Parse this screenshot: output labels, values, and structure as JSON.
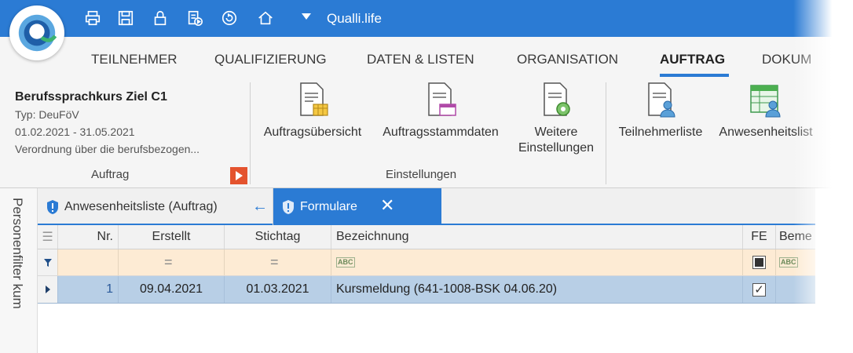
{
  "app": {
    "title": "Qualli.life",
    "brand_color": "#2b7bd4",
    "accent_color": "#e4532e"
  },
  "quick_access": [
    {
      "icon": "print-icon"
    },
    {
      "icon": "save-icon"
    },
    {
      "icon": "lock-icon"
    },
    {
      "icon": "report-play-icon"
    },
    {
      "icon": "refresh-icon"
    },
    {
      "icon": "home-icon"
    }
  ],
  "ribbon_tabs": [
    {
      "label": "TEILNEHMER"
    },
    {
      "label": "QUALIFIZIERUNG"
    },
    {
      "label": "DATEN & LISTEN"
    },
    {
      "label": "ORGANISATION"
    },
    {
      "label": "AUFTRAG",
      "active": true
    },
    {
      "label": "DOKUM"
    }
  ],
  "info": {
    "title": "Berufssprachkurs Ziel C1",
    "type": "Typ: DeuFöV",
    "period": "01.02.2021 - 31.05.2021",
    "regulation": "Verordnung über die berufsbezogen...",
    "group_label": "Auftrag"
  },
  "settings_group": {
    "label": "Einstellungen",
    "buttons": [
      {
        "label": "Auftragsübersicht",
        "icon": "document-table-icon"
      },
      {
        "label": "Auftragsstammdaten",
        "icon": "document-form-icon"
      },
      {
        "label_line1": "Weitere",
        "label_line2": "Einstellungen",
        "icon": "document-settings-icon"
      }
    ]
  },
  "list_group": {
    "buttons": [
      {
        "label": "Teilnehmerliste",
        "icon": "participant-list-icon"
      },
      {
        "label": "Anwesenheitslist",
        "icon": "attendance-list-icon"
      }
    ]
  },
  "side_panel": {
    "label": "Personenfilter  kum"
  },
  "doc_tabs": [
    {
      "label": "Anwesenheitsliste (Auftrag)",
      "icon": "shield-icon"
    },
    {
      "label": "Formulare",
      "icon": "shield-icon",
      "active": true
    }
  ],
  "grid": {
    "columns": [
      "Nr.",
      "Erstellt",
      "Stichtag",
      "Bezeichnung",
      "FE",
      "Beme"
    ],
    "filter_row": {
      "erstellt": "=",
      "stichtag": "=",
      "bezeichnung": "ABC",
      "fe": "indeterminate",
      "beme": "ABC"
    },
    "rows": [
      {
        "nr": "1",
        "erstellt": "09.04.2021",
        "stichtag": "01.03.2021",
        "bezeichnung": "Kursmeldung (641-1008-BSK 04.06.20)",
        "fe": true
      }
    ]
  }
}
